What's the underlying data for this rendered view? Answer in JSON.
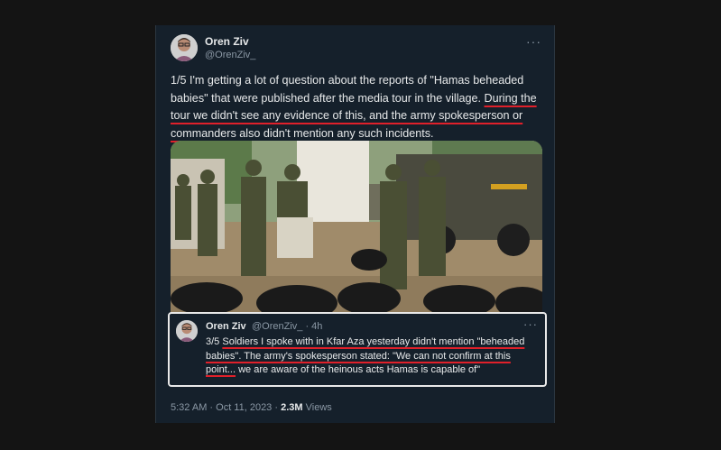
{
  "tweet": {
    "author_name": "Oren Ziv",
    "author_handle": "@OrenZiv_",
    "more_label": "···",
    "text_plain": "1/5 I'm getting a lot of question about the reports of \"Hamas beheaded babies\" that were published after the media tour in the village. ",
    "text_underlined": "During the tour we didn't see any evidence of this, and the army spokesperson or commanders also didn't mention any such incidents.",
    "timestamp": "5:32 AM · Oct 11, 2023 · ",
    "views_count": "2.3M",
    "views_label": " Views"
  },
  "quoted": {
    "author_name": "Oren Ziv",
    "author_handle": "@OrenZiv_ · 4h",
    "more_label": "···",
    "text_prefix": "3/5 ",
    "text_underlined": "Soldiers I spoke with in Kfar Aza yesterday didn't mention \"beheaded babies\". The army's spokesperson stated: \"We can not confirm at this point...",
    "text_suffix": " we are aware of the heinous acts Hamas is capable of\""
  },
  "colors": {
    "background": "#141414",
    "card": "#15202b",
    "text": "#e7e9ea",
    "muted": "#8b98a5",
    "underline": "#e0202a"
  }
}
